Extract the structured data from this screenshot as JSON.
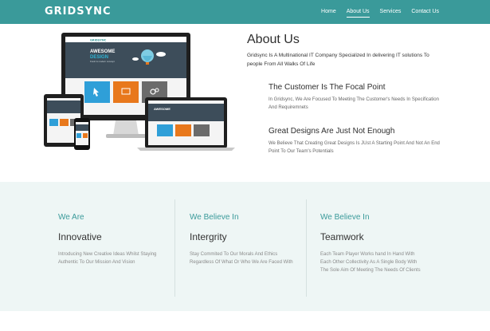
{
  "nav": {
    "brand": "GRIDSYNC",
    "links": [
      {
        "label": "Home"
      },
      {
        "label": "About Us"
      },
      {
        "label": "Services"
      },
      {
        "label": "Contact Us"
      }
    ],
    "active": "About Us"
  },
  "hero": {
    "title": "About Us",
    "intro": "Gridsync Is A Multinational IT Company Specialized In delivering IT solutions To people From All Walks Of Life",
    "features": [
      {
        "title": "The Customer Is The Focal Point",
        "text": "In Gridsync, We Are Focused To Meeting The Customer's Needs In Specification And Requiremnets"
      },
      {
        "title": "Great Designs Are Just Not Enough",
        "text": "We Believe That Creating Great Designs Is JUst A Starting Point And Not An End Point To Our Team's Potentials"
      }
    ],
    "mockup": {
      "screen_logo": "GRIDSYNC",
      "screen_banner_line1": "AWESOME",
      "screen_banner_line2": "DESIGN",
      "screen_banner_sub": "Fresh & modern concept",
      "tablet_banner": "AWESOME"
    }
  },
  "values": [
    {
      "kicker": "We Are",
      "heading": "Innovative",
      "text": "Introducing New Creative Ideas Whilst Staying Authentic To Our Mission And Vision"
    },
    {
      "kicker": "We Believe In",
      "heading": "Intergrity",
      "text": "Stay Commited To Our Morals And Ethics Regardless Of What Or Who We Are Faced With"
    },
    {
      "kicker": "We Believe In",
      "heading": "Teamwork",
      "text": "Each Team Player Works hand In Hand With Each Other Collectivity As A Single Body With The Sole Aim Of Meeting The Needs Of Clients"
    }
  ],
  "colors": {
    "nav": "#3a9a9a",
    "accent": "#3a9a9a",
    "values_bg": "#eef6f5",
    "tile_blue": "#2f9fd8",
    "tile_orange": "#e8781c",
    "tile_gray": "#6b6b6b"
  }
}
